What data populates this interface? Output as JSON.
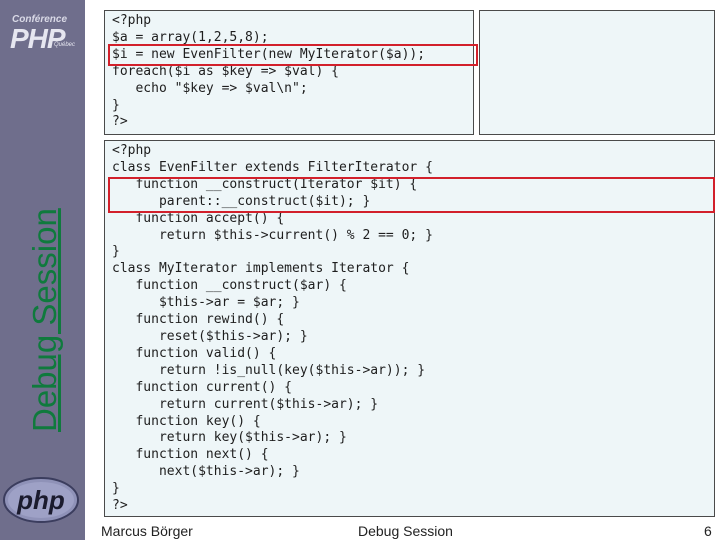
{
  "sidebar": {
    "conference_label": "Conférence",
    "brand": "PHP",
    "location": "Québec",
    "vertical_title": "Debug Session",
    "php_logo_text": "php"
  },
  "code_top": [
    "<?php",
    "$a = array(1,2,5,8);",
    "$i = new EvenFilter(new MyIterator($a));",
    "foreach($i as $key => $val) {",
    "   echo \"$key => $val\\n\";",
    "}",
    "?>"
  ],
  "code_bottom": [
    "<?php",
    "class EvenFilter extends FilterIterator {",
    "   function __construct(Iterator $it) {",
    "      parent::__construct($it); }",
    "   function accept() {",
    "      return $this->current() % 2 == 0; }",
    "}",
    "class MyIterator implements Iterator {",
    "   function __construct($ar) {",
    "      $this->ar = $ar; }",
    "   function rewind() {",
    "      reset($this->ar); }",
    "   function valid() {",
    "      return !is_null(key($this->ar)); }",
    "   function current() {",
    "      return current($this->ar); }",
    "   function key() {",
    "      return key($this->ar); }",
    "   function next() {",
    "      next($this->ar); }",
    "}",
    "?>"
  ],
  "footer": {
    "author": "Marcus Börger",
    "title": "Debug Session",
    "page": "6"
  },
  "colors": {
    "sidebar": "#6f6e8c",
    "title_green": "#0f7a3d",
    "highlight_red": "#d2202b",
    "code_bg": "#eef6f8"
  }
}
